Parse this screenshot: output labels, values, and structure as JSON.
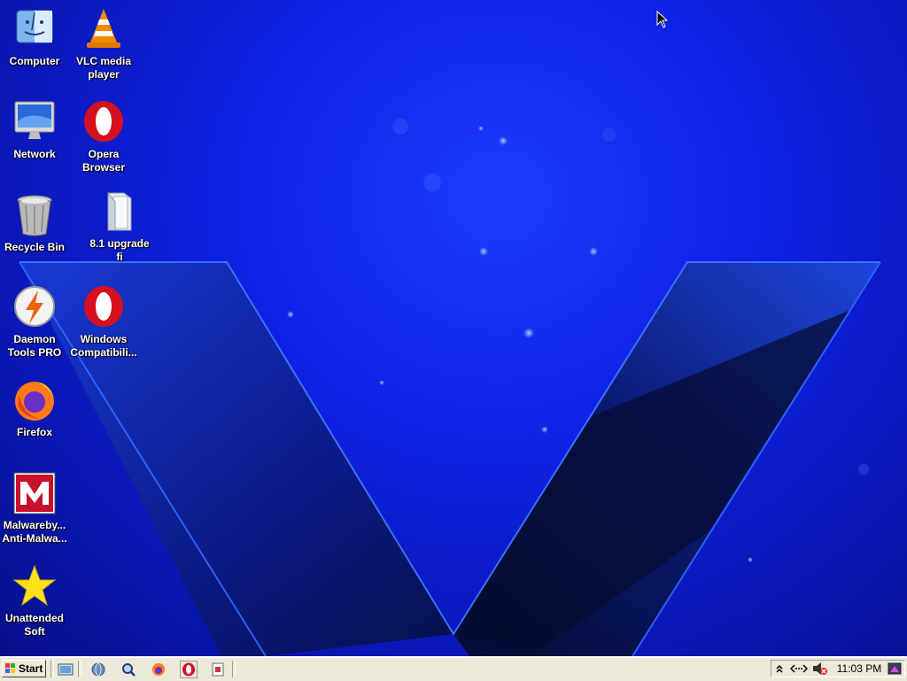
{
  "desktop_icons": [
    {
      "label": "Computer",
      "icon": "finder-computer-icon"
    },
    {
      "label": "VLC media\nplayer",
      "icon": "vlc-cone-icon"
    },
    {
      "label": "Network",
      "icon": "imac-network-icon"
    },
    {
      "label": "Opera\nBrowser",
      "icon": "opera-icon"
    },
    {
      "label": "Recycle Bin",
      "icon": "trash-bin-icon"
    },
    {
      "label": "8.1 upgrade\nfi",
      "icon": "folder-icon"
    },
    {
      "label": "Daemon\nTools PRO",
      "icon": "daemon-tools-icon"
    },
    {
      "label": "Windows\nCompatibili...",
      "icon": "opera-icon"
    },
    {
      "label": "Firefox",
      "icon": "firefox-icon"
    },
    {
      "label": "Malwareby...\nAnti-Malwa...",
      "icon": "malwarebytes-icon"
    },
    {
      "label": "Unattended\nSoft",
      "icon": "star-icon"
    }
  ],
  "taskbar": {
    "start_label": "Start",
    "quick_launch": [
      "show-desktop-icon",
      "browser-globe-icon",
      "search-icon",
      "firefox-icon",
      "opera-icon",
      "app-window-icon"
    ],
    "tray": {
      "icons": [
        "show-hidden-icon",
        "network-status-icon",
        "volume-muted-icon",
        "desktop-tray-icon"
      ],
      "clock": "11:03 PM"
    }
  },
  "colors": {
    "wallpaper_blue": "#0f22e8",
    "taskbar_bg": "#ece9d8",
    "opera_red": "#d5101f",
    "vlc_orange": "#f08a00"
  }
}
